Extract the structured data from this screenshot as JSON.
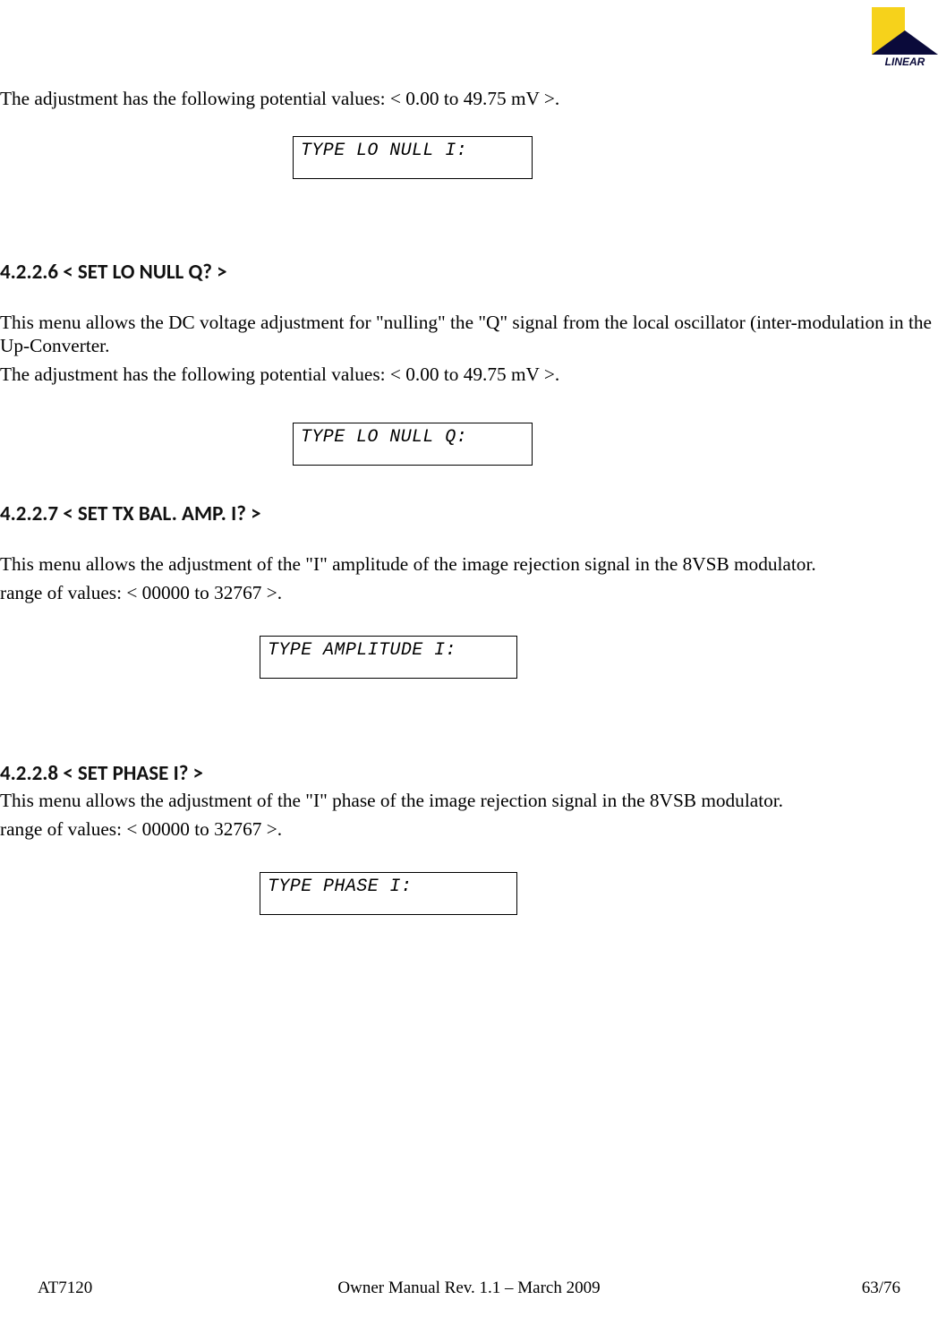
{
  "logo": {
    "brand": "LINEAR"
  },
  "sections": {
    "intro_line_1": "The adjustment has the following potential values: < 0.00 to 49.75 mV >.",
    "box1": "TYPE LO NULL I:",
    "h1": "4.2.2.6 < SET LO NULL Q? >",
    "p1a": "This menu allows the DC voltage adjustment for \"nulling\" the \"Q\" signal from the local oscillator (inter-modulation in the Up-Converter.",
    "p1b": "The adjustment has the following potential values: < 0.00 to 49.75 mV >.",
    "box2": "TYPE LO NULL Q:",
    "h2": "4.2.2.7 < SET TX BAL. AMP. I? >",
    "p2a": "This menu allows the adjustment of the \"I\" amplitude of the image rejection signal in the 8VSB modulator.",
    "p2b": "range of values: < 00000 to 32767 >.",
    "box3": "TYPE AMPLITUDE I:",
    "h3": "4.2.2.8 < SET PHASE I? >",
    "p3a": "This menu allows the adjustment of the \"I\" phase of the image rejection signal in the 8VSB modulator.",
    "p3b": "range of values: < 00000 to 32767 >.",
    "box4": "TYPE PHASE I:"
  },
  "footer": {
    "left": "AT7120",
    "center": "Owner Manual Rev. 1.1 – March 2009",
    "right": "63/76"
  }
}
